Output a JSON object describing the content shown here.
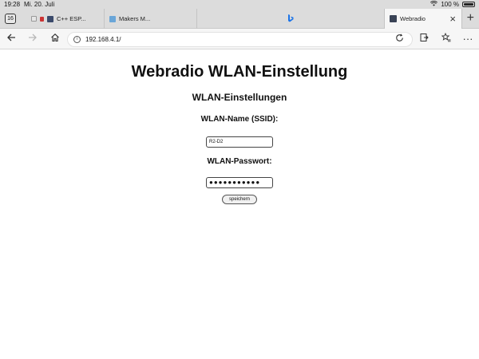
{
  "status_bar": {
    "time": "19:28",
    "date": "Mi. 20. Juli",
    "battery": "100 %"
  },
  "tabs": {
    "count": "16",
    "items": [
      {
        "label": "C++ ESP..."
      },
      {
        "label": "Makers M..."
      },
      {
        "label": ""
      },
      {
        "label": "Webradio"
      }
    ]
  },
  "address_bar": {
    "url": "192.168.4.1/"
  },
  "page": {
    "title": "Webradio WLAN-Einstellung",
    "section_heading": "WLAN-Einstellungen",
    "ssid_label": "WLAN-Name (SSID):",
    "ssid_value": "R2-D2",
    "password_label": "WLAN-Passwort:",
    "password_value": "●●●●●●●●●●●",
    "save_label": "speichern"
  }
}
